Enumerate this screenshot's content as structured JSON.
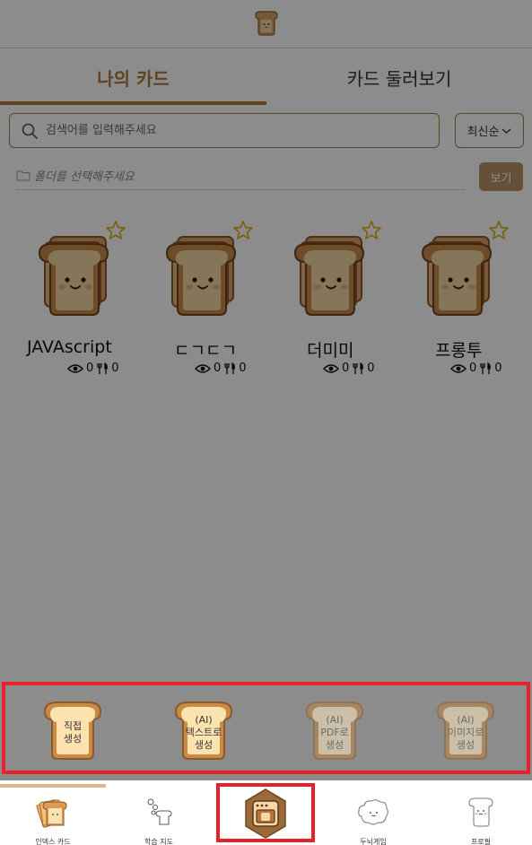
{
  "tabs": {
    "mine": "나의 카드",
    "browse": "카드 둘러보기"
  },
  "search": {
    "placeholder": "검색어를 입력해주세요"
  },
  "sort": {
    "label": "최신순"
  },
  "folder": {
    "placeholder": "폴더를 선택해주세요",
    "view_button": "보기"
  },
  "cards": [
    {
      "title": "JAVAscript",
      "views": "0",
      "forks": "0"
    },
    {
      "title": "ㄷㄱㄷㄱ",
      "views": "0",
      "forks": "0"
    },
    {
      "title": "더미미",
      "views": "0",
      "forks": "0"
    },
    {
      "title": "프롱투",
      "views": "0",
      "forks": "0"
    }
  ],
  "create_options": [
    {
      "line1": "직접",
      "line2": "생성",
      "line3": "",
      "enabled": true
    },
    {
      "line1": "(AI)",
      "line2": "텍스트로",
      "line3": "생성",
      "enabled": true
    },
    {
      "line1": "(AI)",
      "line2": "PDF로",
      "line3": "생성",
      "enabled": false
    },
    {
      "line1": "(AI)",
      "line2": "이미지로",
      "line3": "생성",
      "enabled": false
    }
  ],
  "bottom_nav": [
    {
      "label": "인덱스 카드",
      "icon": "card-stack-icon"
    },
    {
      "label": "학습 지도",
      "icon": "study-map-icon"
    },
    {
      "label": "",
      "icon": "toaster-oven-icon"
    },
    {
      "label": "두뇌게임",
      "icon": "brain-game-icon"
    },
    {
      "label": "프로필",
      "icon": "profile-bread-icon"
    }
  ],
  "colors": {
    "accent": "#b07a3b",
    "overlay": "rgba(0,0,0,0.45)",
    "highlight": "#e8222d",
    "bread_crust": "#c88a4a",
    "bread_face": "#f3d7a2"
  }
}
